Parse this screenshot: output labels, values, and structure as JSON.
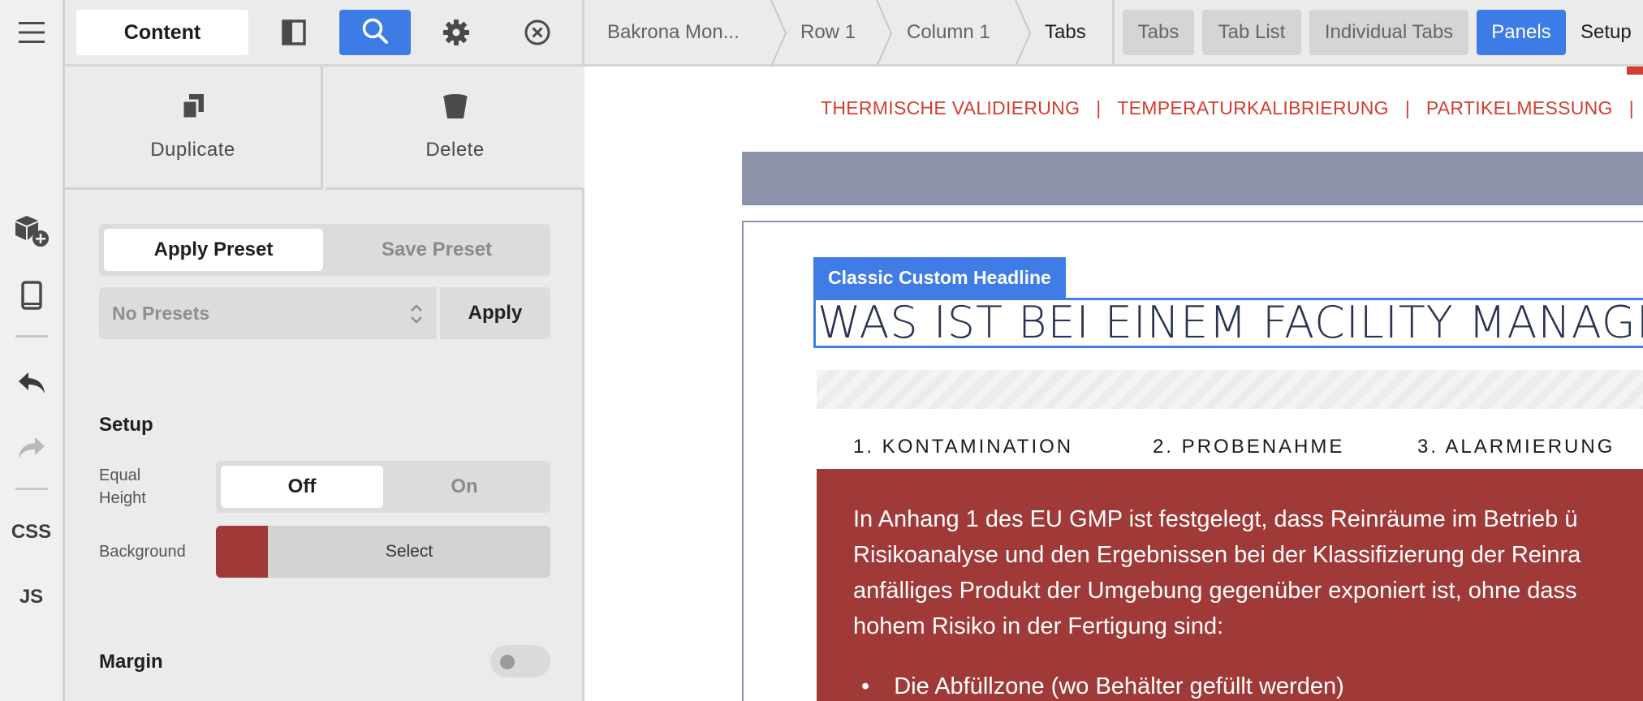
{
  "toolbar": {
    "content_tab": "Content"
  },
  "actions": {
    "duplicate": "Duplicate",
    "delete": "Delete"
  },
  "presets": {
    "apply_preset": "Apply Preset",
    "save_preset": "Save Preset",
    "select_value": "No Presets",
    "apply_button": "Apply"
  },
  "setup": {
    "title": "Setup",
    "equal_height_label_1": "Equal",
    "equal_height_label_2": "Height",
    "equal_height_off": "Off",
    "equal_height_on": "On",
    "equal_height_value": "Off",
    "background_label": "Background",
    "background_select": "Select",
    "background_color": "#a03a38"
  },
  "margin": {
    "title": "Margin",
    "enabled": false
  },
  "rail": {
    "css": "CSS",
    "js": "JS"
  },
  "breadcrumb": [
    "Bakrona Mon...",
    "Row 1",
    "Column 1",
    "Tabs"
  ],
  "element_tabs": {
    "items": [
      "Tabs",
      "Tab List",
      "Individual Tabs",
      "Panels",
      "Setup"
    ],
    "active": "Panels"
  },
  "preview": {
    "nav_links": [
      "THERMISCHE VALIDIERUNG",
      "TEMPERATURKALIBRIERUNG",
      "PARTIKELMESSUNG"
    ],
    "headline_tag": "Classic Custom Headline",
    "headline": "WAS IST BEI EINEM FACILITY MANAGEME",
    "tabs": [
      "1. KONTAMINATION",
      "2. PROBENAHME",
      "3. ALARMIERUNG"
    ],
    "panel_lines": [
      "In Anhang 1 des EU GMP ist festgelegt, dass Reinräume im Betrieb ü",
      "Risikoanalyse und den Ergebnissen bei der Klassifizierung der Reinra",
      "anfälliges Produkt der Umgebung gegenüber exponiert ist, ohne dass",
      "hohem Risiko in der Fertigung sind:"
    ],
    "bullet": "Die Abfüllzone (wo Behälter gefüllt werden)"
  },
  "colors": {
    "accent_blue": "#3d7be6",
    "nav_red": "#d33d2f",
    "panel_red": "#a03a38",
    "headline_navy": "#2a3452"
  }
}
